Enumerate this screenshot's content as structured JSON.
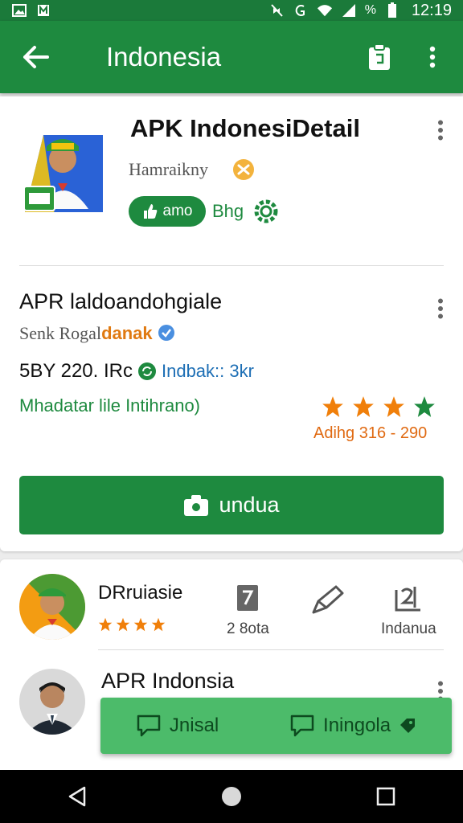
{
  "status_bar": {
    "time": "12:19",
    "battery_pct": "%"
  },
  "app_bar": {
    "title": "Indonesia"
  },
  "app_card": {
    "name": "APK IndonesiDetail",
    "developer": "Hamraikny",
    "chip_label": "amo",
    "chip_label_2": "Bhg"
  },
  "details": {
    "title": "APR laldoandohgiale",
    "subtitle_plain": "Senk Rogal",
    "subtitle_accent": "danak",
    "price_text": "5BY 220. IRc",
    "price_link": "Indbak:: 3kr",
    "green_link": "Mhadatar lile Intihrano)",
    "rating_value": 4,
    "rating_text": "Adihg 316 - 290",
    "install_label": "undua"
  },
  "reviews": {
    "first": {
      "name": "DRruiasie",
      "stars": 4
    },
    "stats": [
      {
        "label": "2 8ota",
        "icon": "document-icon"
      },
      {
        "label": "",
        "icon": "pencil-icon"
      },
      {
        "label": "Indanua",
        "icon": "sizes-icon"
      }
    ],
    "second": {
      "name": "APR Indonsia"
    }
  },
  "snackbar": {
    "action_1": "Jnisal",
    "action_2": "Iningola"
  },
  "colors": {
    "primary": "#1e8a3f",
    "accent_orange": "#e07a12",
    "link_blue": "#1e6fb5",
    "snackbar_green": "#4cbb6a"
  }
}
